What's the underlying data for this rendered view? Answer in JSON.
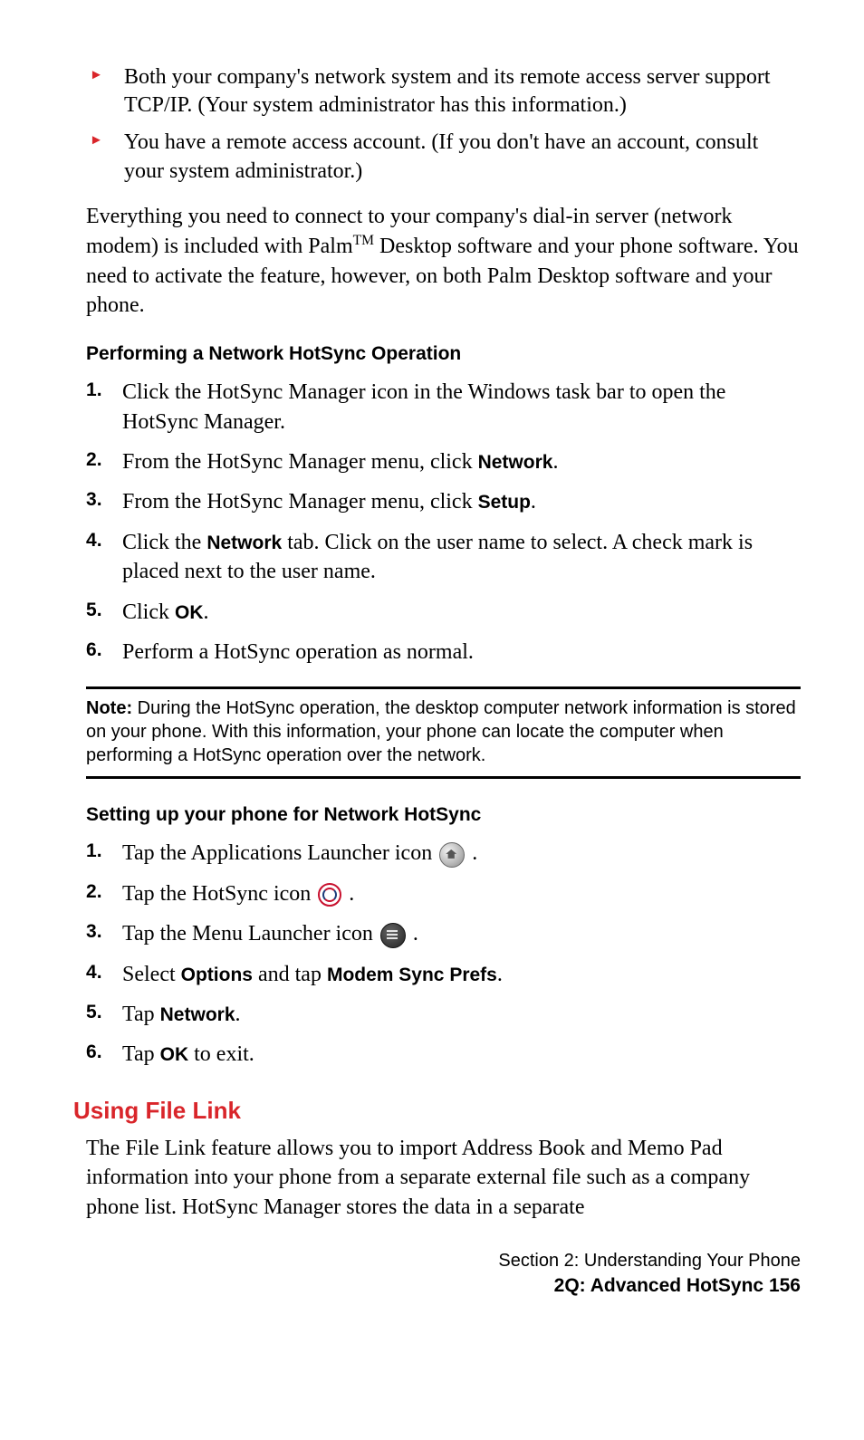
{
  "bullets": [
    "Both your company's network system and its remote access server support TCP/IP. (Your system administrator has this information.)",
    "You have a remote access account. (If you don't have an account, consult your system administrator.)"
  ],
  "intro_para_pre": "Everything you need to connect to your company's dial-in server (network modem) is included with Palm",
  "tm": "TM",
  "intro_para_post": " Desktop software and your phone software. You need to activate the feature, however, on both Palm Desktop software and your phone.",
  "subhead1": "Performing a Network HotSync Operation",
  "steps1": {
    "s1": "Click the HotSync Manager icon in the Windows task bar to open the HotSync Manager.",
    "s2_pre": "From the HotSync Manager menu, click ",
    "s2_b": "Network",
    "s2_post": ".",
    "s3_pre": "From the HotSync Manager menu, click ",
    "s3_b": "Setup",
    "s3_post": ".",
    "s4_pre": "Click the ",
    "s4_b": "Network",
    "s4_post": " tab. Click on the user name to select. A check mark is placed next to the user name.",
    "s5_pre": "Click ",
    "s5_b": "OK",
    "s5_post": ".",
    "s6": "Perform a HotSync operation as normal."
  },
  "note_label": "Note:",
  "note_body": " During the HotSync operation, the desktop computer network information is stored on your phone. With this information, your phone can locate the computer when performing a HotSync operation over the network.",
  "subhead2": "Setting up your phone for Network HotSync",
  "steps2": {
    "s1_pre": "Tap the Applications Launcher icon ",
    "s1_post": " .",
    "s2_pre": "Tap the HotSync icon ",
    "s2_post": ".",
    "s3_pre": "Tap the Menu Launcher icon ",
    "s3_post": " .",
    "s4_pre": "Select ",
    "s4_b1": "Options",
    "s4_mid": " and tap ",
    "s4_b2": "Modem Sync Prefs",
    "s4_post": ".",
    "s5_pre": "Tap ",
    "s5_b": "Network",
    "s5_post": ".",
    "s6_pre": "Tap ",
    "s6_b": "OK",
    "s6_post": " to exit."
  },
  "section_red": "Using File Link",
  "filelink_para": "The File Link feature allows you to import Address Book and Memo Pad information into your phone from a separate external file such as a company phone list. HotSync Manager stores the data in a separate",
  "footer_l1": "Section 2: Understanding Your Phone",
  "footer_l2": "2Q: Advanced HotSync   156"
}
